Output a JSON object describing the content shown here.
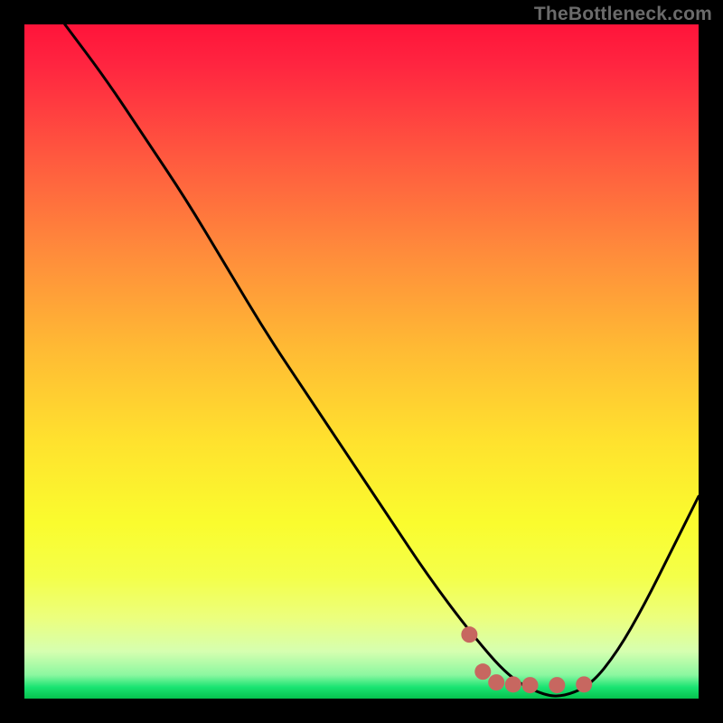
{
  "watermark": "TheBottleneck.com",
  "colors": {
    "frame_border": "#000000",
    "curve": "#000000",
    "marker_fill": "#c76760",
    "marker_stroke": "#c76760"
  },
  "chart_data": {
    "type": "line",
    "title": "",
    "xlabel": "",
    "ylabel": "",
    "xlim": [
      0,
      100
    ],
    "ylim": [
      0,
      100
    ],
    "grid": false,
    "legend": false,
    "series": [
      {
        "name": "bottleneck-curve",
        "x": [
          6,
          12,
          18,
          24,
          30,
          36,
          42,
          48,
          54,
          60,
          66,
          72,
          77,
          80,
          84,
          88,
          92,
          96,
          100
        ],
        "y": [
          100,
          92,
          83,
          74,
          64,
          54,
          45,
          36,
          27,
          18,
          10,
          3,
          0.5,
          0.3,
          2,
          7,
          14,
          22,
          30
        ]
      }
    ],
    "markers": [
      {
        "name": "point-a",
        "x": 66,
        "y": 9.5
      },
      {
        "name": "point-b",
        "x": 68,
        "y": 4.0
      },
      {
        "name": "point-c",
        "x": 70,
        "y": 2.4
      },
      {
        "name": "point-d",
        "x": 72.5,
        "y": 2.1
      },
      {
        "name": "point-e",
        "x": 75,
        "y": 2.0
      },
      {
        "name": "point-f",
        "x": 79,
        "y": 2.0
      },
      {
        "name": "minimum",
        "x": 83,
        "y": 2.1
      }
    ]
  }
}
